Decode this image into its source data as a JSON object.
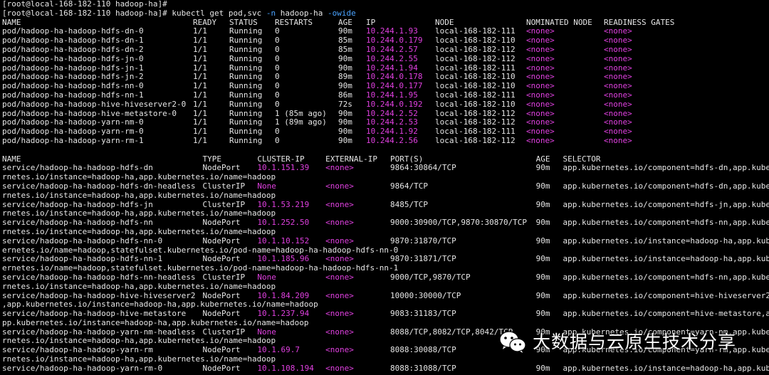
{
  "terminal": {
    "prompt1": "[root@local-168-182-110 hadoop-ha]#",
    "prompt2": "[root@local-168-182-110 hadoop-ha]# ",
    "cmd_main": "kubectl get pod,svc ",
    "cmd_flag1": "-n",
    "cmd_ns": " hadoop-ha ",
    "cmd_flag2": "-owide"
  },
  "pods": {
    "headers": [
      "NAME",
      "READY",
      "STATUS",
      "RESTARTS",
      "AGE",
      "IP",
      "NODE",
      "NOMINATED NODE",
      "READINESS GATES"
    ],
    "rows": [
      [
        "pod/hadoop-ha-hadoop-hdfs-dn-0",
        "1/1",
        "Running",
        "0",
        "90m",
        "10.244.1.93",
        "local-168-182-111",
        "<none>",
        "<none>"
      ],
      [
        "pod/hadoop-ha-hadoop-hdfs-dn-1",
        "1/1",
        "Running",
        "0",
        "85m",
        "10.244.0.179",
        "local-168-182-110",
        "<none>",
        "<none>"
      ],
      [
        "pod/hadoop-ha-hadoop-hdfs-dn-2",
        "1/1",
        "Running",
        "0",
        "85m",
        "10.244.2.57",
        "local-168-182-112",
        "<none>",
        "<none>"
      ],
      [
        "pod/hadoop-ha-hadoop-hdfs-jn-0",
        "1/1",
        "Running",
        "0",
        "90m",
        "10.244.2.55",
        "local-168-182-112",
        "<none>",
        "<none>"
      ],
      [
        "pod/hadoop-ha-hadoop-hdfs-jn-1",
        "1/1",
        "Running",
        "0",
        "90m",
        "10.244.1.94",
        "local-168-182-111",
        "<none>",
        "<none>"
      ],
      [
        "pod/hadoop-ha-hadoop-hdfs-jn-2",
        "1/1",
        "Running",
        "0",
        "89m",
        "10.244.0.178",
        "local-168-182-110",
        "<none>",
        "<none>"
      ],
      [
        "pod/hadoop-ha-hadoop-hdfs-nn-0",
        "1/1",
        "Running",
        "0",
        "90m",
        "10.244.0.177",
        "local-168-182-110",
        "<none>",
        "<none>"
      ],
      [
        "pod/hadoop-ha-hadoop-hdfs-nn-1",
        "1/1",
        "Running",
        "0",
        "86m",
        "10.244.1.95",
        "local-168-182-111",
        "<none>",
        "<none>"
      ],
      [
        "pod/hadoop-ha-hadoop-hive-hiveserver2-0",
        "1/1",
        "Running",
        "0",
        "72s",
        "10.244.0.192",
        "local-168-182-110",
        "<none>",
        "<none>"
      ],
      [
        "pod/hadoop-ha-hadoop-hive-metastore-0",
        "1/1",
        "Running",
        "1 (85m ago)",
        "90m",
        "10.244.2.52",
        "local-168-182-112",
        "<none>",
        "<none>"
      ],
      [
        "pod/hadoop-ha-hadoop-yarn-nm-0",
        "1/1",
        "Running",
        "1 (89m ago)",
        "90m",
        "10.244.2.53",
        "local-168-182-112",
        "<none>",
        "<none>"
      ],
      [
        "pod/hadoop-ha-hadoop-yarn-rm-0",
        "1/1",
        "Running",
        "0",
        "90m",
        "10.244.1.92",
        "local-168-182-111",
        "<none>",
        "<none>"
      ],
      [
        "pod/hadoop-ha-hadoop-yarn-rm-1",
        "1/1",
        "Running",
        "0",
        "90m",
        "10.244.2.56",
        "local-168-182-112",
        "<none>",
        "<none>"
      ]
    ]
  },
  "services": {
    "headers": [
      "NAME",
      "TYPE",
      "CLUSTER-IP",
      "EXTERNAL-IP",
      "PORT(S)",
      "AGE",
      "SELECTOR"
    ],
    "rows": [
      {
        "cells": [
          "service/hadoop-ha-hadoop-hdfs-dn",
          "NodePort",
          "10.1.151.39",
          "<none>",
          "9864:30864/TCP",
          "90m",
          "app.kubernetes.io/component=hdfs-dn,app.kube"
        ],
        "wrap": "rnetes.io/instance=hadoop-ha,app.kubernetes.io/name=hadoop"
      },
      {
        "cells": [
          "service/hadoop-ha-hadoop-hdfs-dn-headless",
          "ClusterIP",
          "None",
          "<none>",
          "9864/TCP",
          "90m",
          "app.kubernetes.io/component=hdfs-dn,app.kube"
        ],
        "wrap": "rnetes.io/instance=hadoop-ha,app.kubernetes.io/name=hadoop"
      },
      {
        "cells": [
          "service/hadoop-ha-hadoop-hdfs-jn",
          "ClusterIP",
          "10.1.53.219",
          "<none>",
          "8485/TCP",
          "90m",
          "app.kubernetes.io/component=hdfs-jn,app.kube"
        ],
        "wrap": "rnetes.io/instance=hadoop-ha,app.kubernetes.io/name=hadoop"
      },
      {
        "cells": [
          "service/hadoop-ha-hadoop-hdfs-nn",
          "NodePort",
          "10.1.252.50",
          "<none>",
          "9000:30900/TCP,9870:30870/TCP",
          "90m",
          "app.kubernetes.io/component=hdfs-nn,app.kube"
        ],
        "wrap": "rnetes.io/instance=hadoop-ha,app.kubernetes.io/name=hadoop"
      },
      {
        "cells": [
          "service/hadoop-ha-hadoop-hdfs-nn-0",
          "NodePort",
          "10.1.10.152",
          "<none>",
          "9870:31870/TCP",
          "90m",
          "app.kubernetes.io/instance=hadoop-ha,app.kub"
        ],
        "wrap": "ernetes.io/name=hadoop,statefulset.kubernetes.io/pod-name=hadoop-ha-hadoop-hdfs-nn-0"
      },
      {
        "cells": [
          "service/hadoop-ha-hadoop-hdfs-nn-1",
          "NodePort",
          "10.1.185.96",
          "<none>",
          "9870:31871/TCP",
          "90m",
          "app.kubernetes.io/instance=hadoop-ha,app.kub"
        ],
        "wrap": "ernetes.io/name=hadoop,statefulset.kubernetes.io/pod-name=hadoop-ha-hadoop-hdfs-nn-1"
      },
      {
        "cells": [
          "service/hadoop-ha-hadoop-hdfs-nn-headless",
          "ClusterIP",
          "None",
          "<none>",
          "9000/TCP,9870/TCP",
          "90m",
          "app.kubernetes.io/component=hdfs-nn,app.kube"
        ],
        "wrap": "rnetes.io/instance=hadoop-ha,app.kubernetes.io/name=hadoop"
      },
      {
        "cells": [
          "service/hadoop-ha-hadoop-hive-hiveserver2",
          "NodePort",
          "10.1.84.209",
          "<none>",
          "10000:30000/TCP",
          "90m",
          "app.kubernetes.io/component=hive-hiveserver2"
        ],
        "wrap": ",app.kubernetes.io/instance=hadoop-ha,app.kubernetes.io/name=hadoop"
      },
      {
        "cells": [
          "service/hadoop-ha-hadoop-hive-metastore",
          "NodePort",
          "10.1.237.94",
          "<none>",
          "9083:31183/TCP",
          "90m",
          "app.kubernetes.io/component=hive-metastore,a"
        ],
        "wrap": "pp.kubernetes.io/instance=hadoop-ha,app.kubernetes.io/name=hadoop"
      },
      {
        "cells": [
          "service/hadoop-ha-hadoop-yarn-nm-headless",
          "ClusterIP",
          "None",
          "<none>",
          "8088/TCP,8082/TCP,8042/TCP",
          "90m",
          "app.kubernetes.io/component=yarn-nm,app.kube"
        ],
        "wrap": "rnetes.io/instance=hadoop-ha,app.kubernetes.io/name=hadoop"
      },
      {
        "cells": [
          "service/hadoop-ha-hadoop-yarn-rm",
          "NodePort",
          "10.1.69.7",
          "<none>",
          "8088:30088/TCP",
          "90m",
          "app.kubernetes.io/component=yarn-rm,app.kube"
        ],
        "wrap": "rnetes.io/instance=hadoop-ha,app.kubernetes.io/name=hadoop"
      },
      {
        "cells": [
          "service/hadoop-ha-hadoop-yarn-rm-0",
          "NodePort",
          "10.1.108.194",
          "<none>",
          "8088:31088/TCP",
          "90m",
          "app.kubernetes.io/instance=hadoop-ha,app.kub"
        ],
        "wrap": ""
      }
    ]
  },
  "watermark": {
    "text": "大数据与云原生技术分享",
    "icon": "wechat-icon"
  },
  "colors": {
    "background": "#000000",
    "text": "#e6e6e6",
    "flag": "#4aa3ff",
    "highlight": "#e040e0"
  }
}
